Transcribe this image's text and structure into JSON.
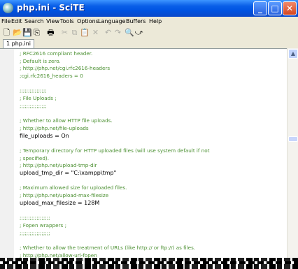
{
  "window": {
    "title": "php.ini - SciTE",
    "buttons": [
      "_",
      "□",
      "✕"
    ]
  },
  "menu": [
    "File",
    "Edit",
    "Search",
    "View",
    "Tools",
    "Options",
    "Language",
    "Buffers",
    "Help"
  ],
  "toolbar": {
    "icons": [
      "new-file-icon",
      "open-folder-icon",
      "save-icon",
      "save-as-icon",
      "print-icon",
      "cut-icon",
      "copy-icon",
      "paste-icon",
      "delete-icon",
      "undo-icon",
      "redo-icon",
      "find-icon",
      "find-replace-icon"
    ]
  },
  "tabs": [
    {
      "label": "1 php.ini"
    }
  ],
  "editor": {
    "lines": [
      {
        "text": "; RFC2616 compliant header.",
        "kind": "comment"
      },
      {
        "text": "; Default is zero.",
        "kind": "comment"
      },
      {
        "text": "; http://php.net/cgi.rfc2616-headers",
        "kind": "comment"
      },
      {
        "text": ";cgi.rfc2616_headers = 0",
        "kind": "comment"
      },
      {
        "text": "",
        "kind": "blank"
      },
      {
        "text": ";;;;;;;;;;;;;;;;",
        "kind": "comment"
      },
      {
        "text": "; File Uploads ;",
        "kind": "comment"
      },
      {
        "text": ";;;;;;;;;;;;;;;;",
        "kind": "comment"
      },
      {
        "text": "",
        "kind": "blank"
      },
      {
        "text": "; Whether to allow HTTP file uploads.",
        "kind": "comment"
      },
      {
        "text": "; http://php.net/file-uploads",
        "kind": "comment"
      },
      {
        "text": "file_uploads = On",
        "kind": "code"
      },
      {
        "text": "",
        "kind": "blank"
      },
      {
        "text": "; Temporary directory for HTTP uploaded files (will use system default if not",
        "kind": "comment"
      },
      {
        "text": "; specified).",
        "kind": "comment"
      },
      {
        "text": "; http://php.net/upload-tmp-dir",
        "kind": "comment"
      },
      {
        "text": "upload_tmp_dir = \"C:\\xampp\\tmp\"",
        "kind": "code"
      },
      {
        "text": "",
        "kind": "blank"
      },
      {
        "text": "; Maximum allowed size for uploaded files.",
        "kind": "comment"
      },
      {
        "text": "; http://php.net/upload-max-filesize",
        "kind": "comment"
      },
      {
        "text": "upload_max_filesize = 128M",
        "kind": "code"
      },
      {
        "text": "",
        "kind": "blank"
      },
      {
        "text": ";;;;;;;;;;;;;;;;;;",
        "kind": "comment"
      },
      {
        "text": "; Fopen wrappers ;",
        "kind": "comment"
      },
      {
        "text": ";;;;;;;;;;;;;;;;;;",
        "kind": "comment"
      },
      {
        "text": "",
        "kind": "blank"
      },
      {
        "text": "; Whether to allow the treatment of URLs (like http:// or ftp://) as files.",
        "kind": "comment"
      },
      {
        "text": "; http://php.net/allow-url-fopen",
        "kind": "comment"
      }
    ]
  },
  "colors": {
    "comment": "#4a8f30",
    "code": "#000000",
    "titlebar": "#0054e3"
  }
}
